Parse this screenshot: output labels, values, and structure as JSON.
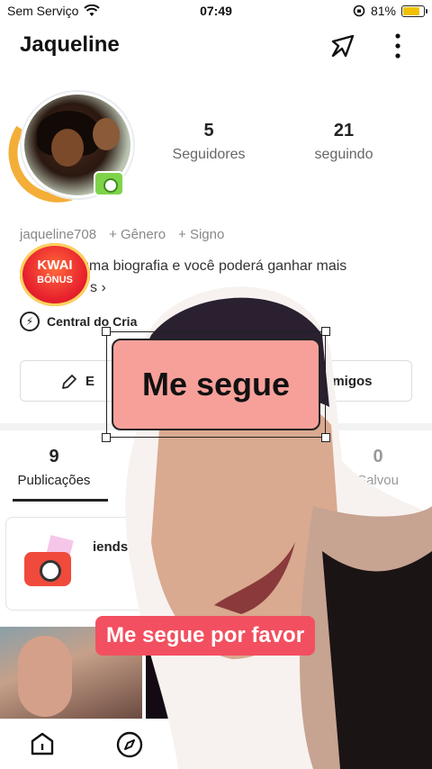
{
  "status_bar": {
    "carrier": "Sem Serviço",
    "time": "07:49",
    "battery": "81%",
    "battery_level": 0.81,
    "battery_color": "#f2c100"
  },
  "header": {
    "username": "Jaqueline",
    "share_icon": "share-arrow-icon",
    "more_icon": "vertical-dots-icon"
  },
  "profile": {
    "stats": {
      "followers_count": "5",
      "followers_label": "Seguidores",
      "following_count": "21",
      "following_label": "seguindo"
    },
    "handle": "jaqueline708",
    "add_gender": "+ Gênero",
    "add_sign": "+ Signo",
    "bio_line1": "uma biografia e você poderá ganhar mais",
    "bio_line2": "s",
    "kwai_badge": {
      "line1": "KWAI",
      "line2": "BÔNUS"
    },
    "creator_center": "Central do Cria",
    "edit_button": "E",
    "friends_button": "amigos"
  },
  "tabs": [
    {
      "count": "9",
      "label": "Publicações"
    },
    {
      "count": "0",
      "label": "Salvou"
    }
  ],
  "card": {
    "text": "iends   Sha"
  },
  "overlay": {
    "sticker_text": "Me segue",
    "sticker_color": "#f7a09a",
    "caption_text": "Me segue por favor",
    "caption_color": "#f25060"
  },
  "bottom_nav": {
    "home_icon": "home-icon",
    "discover_icon": "compass-icon"
  }
}
